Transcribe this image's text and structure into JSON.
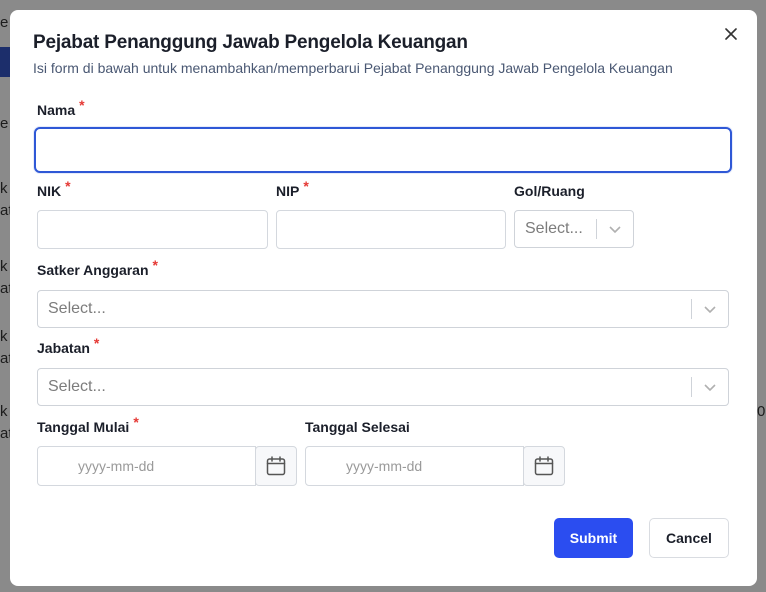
{
  "modal": {
    "title": "Pejabat Penanggung Jawab Pengelola Keuangan",
    "subtitle": "Isi form di bawah untuk menambahkan/memperbarui Pejabat Penanggung Jawab Pengelola Keuangan",
    "close_icon": "close-icon"
  },
  "form": {
    "nama": {
      "label": "Nama",
      "required": "*",
      "value": ""
    },
    "nik": {
      "label": "NIK",
      "required": "*",
      "value": ""
    },
    "nip": {
      "label": "NIP",
      "required": "*",
      "value": ""
    },
    "gol_ruang": {
      "label": "Gol/Ruang",
      "placeholder": "Select..."
    },
    "satker_anggaran": {
      "label": "Satker Anggaran",
      "required": "*",
      "placeholder": "Select..."
    },
    "jabatan": {
      "label": "Jabatan",
      "required": "*",
      "placeholder": "Select..."
    },
    "tanggal_mulai": {
      "label": "Tanggal Mulai",
      "required": "*",
      "placeholder": "yyyy-mm-dd"
    },
    "tanggal_selesai": {
      "label": "Tanggal Selesai",
      "placeholder": "yyyy-mm-dd"
    }
  },
  "actions": {
    "submit_label": "Submit",
    "cancel_label": "Cancel"
  },
  "background": {
    "fragments": [
      "e",
      "e",
      "k",
      "at",
      "k",
      "at",
      "k",
      "at",
      "k",
      "at",
      "0"
    ]
  },
  "colors": {
    "primary": "#2b4df0",
    "focus_border": "#2f58d6",
    "required": "#e53935"
  }
}
